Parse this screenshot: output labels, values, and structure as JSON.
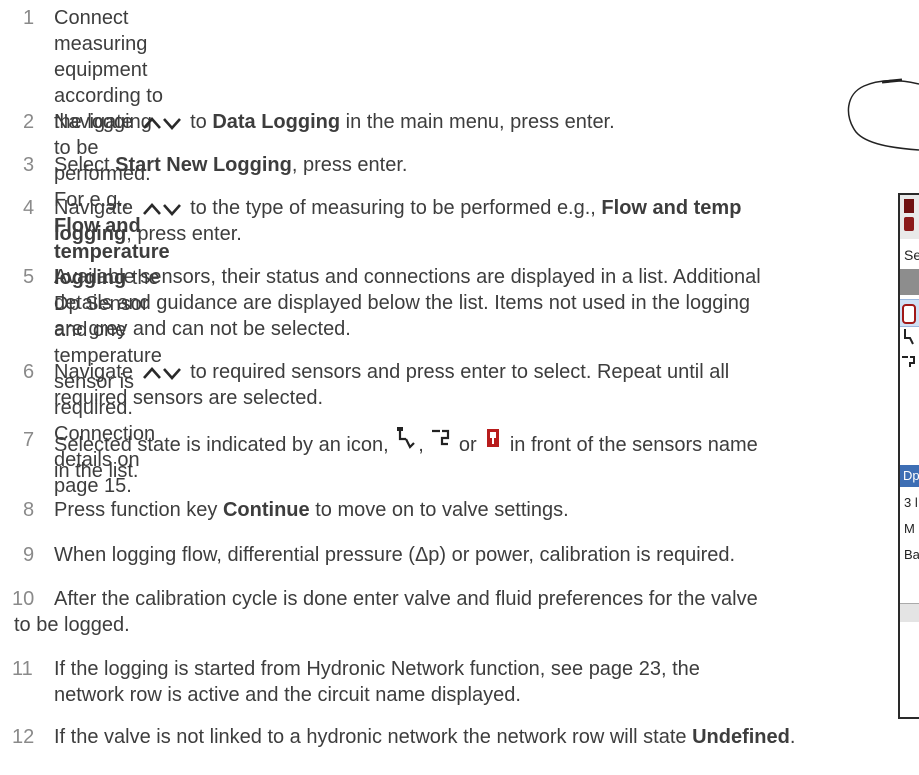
{
  "steps": [
    {
      "num": "1",
      "lines": [
        "Connect measuring equipment according to the logging to be performed.",
        "For e.g.,",
        "Flow and temperature logging",
        "the Dp Sensor and one",
        "temperature sensor is required. Connection details on page 15."
      ]
    },
    {
      "num": "2",
      "a": "Navigate",
      "b": "to",
      "bold": "Data Logging",
      "c": "in the main menu, press enter."
    },
    {
      "num": "3",
      "a": "Select",
      "bold": "Start New Logging",
      "c": ", press enter."
    },
    {
      "num": "4",
      "a": "Navigate",
      "b": "to the type of measuring to be performed e.g.,",
      "bold1": "Flow and temp",
      "bold2": "logging",
      "c": ", press enter."
    },
    {
      "num": "5",
      "lines": [
        "Available sensors, their status and connections are displayed in a list. Additional",
        "details and guidance are displayed below the list. Items not used in the logging",
        "are grey and can not be selected."
      ]
    },
    {
      "num": "6",
      "a": "Navigate",
      "b": "to required sensors and press enter to select. Repeat until all",
      "line2": "required sensors are selected."
    },
    {
      "num": "7",
      "a": "Selected state is indicated by an icon,",
      "sep1": ",",
      "sep2": "or",
      "b": "in front of the sensors name",
      "line2": "in the list."
    },
    {
      "num": "8",
      "a": "Press function key",
      "bold": "Continue",
      "c": "to move on to valve settings."
    },
    {
      "num": "9",
      "text": "When logging flow, differential pressure (Δp) or power, calibration is required."
    },
    {
      "num": "10",
      "lines": [
        "After the calibration cycle is done enter valve and fluid preferences for the valve",
        "to be logged."
      ]
    },
    {
      "num": "11",
      "lines": [
        "If the logging is started from Hydronic Network function, see page 23, the",
        "network row is active and the circuit name displayed."
      ]
    },
    {
      "num": "12",
      "a": "If the valve is not linked to a hydronic network the network row will state",
      "bold": "Undefined",
      "c": "."
    }
  ],
  "device_screen": {
    "row_se": "Se",
    "row_dp": "Dp",
    "row_3": "3 l",
    "row_m": "M",
    "row_ba": "Ba"
  },
  "colors": {
    "accent_red": "#a01818",
    "selection_blue": "#cfe0f5",
    "text": "#3d3d3d",
    "number": "#8a8a8a"
  }
}
